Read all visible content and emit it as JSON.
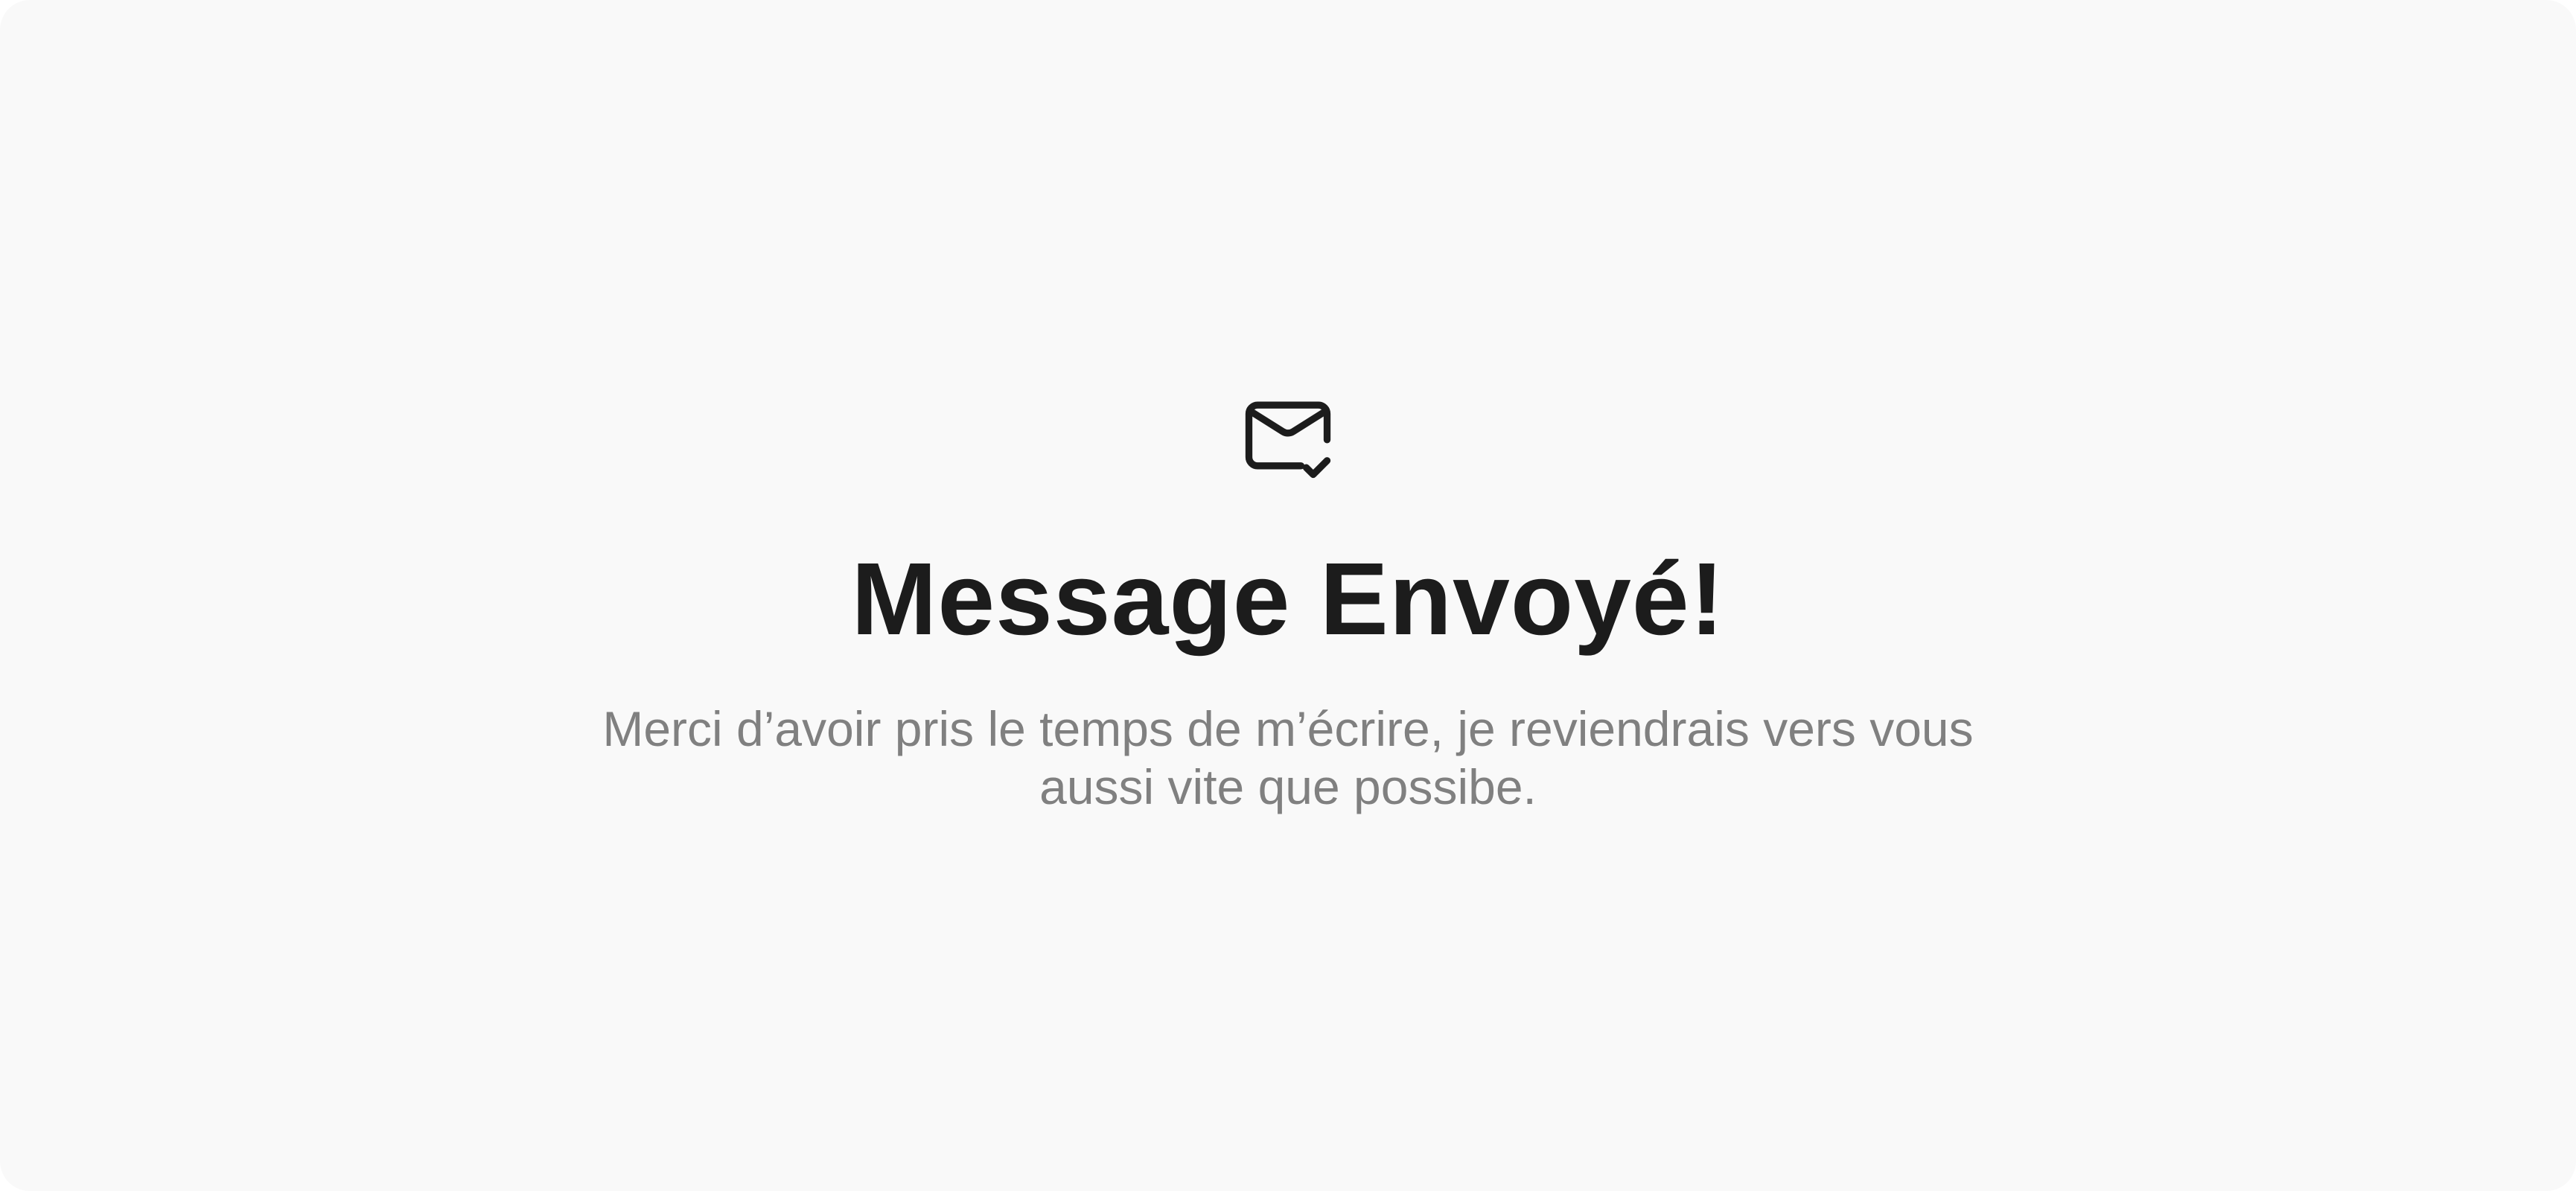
{
  "colors": {
    "background": "#f9f9f9",
    "title": "#1c1c1c",
    "message": "#808080",
    "icon": "#1c1c1c"
  },
  "confirmation": {
    "icon": "mail-check-icon",
    "title": "Message Envoyé!",
    "message": "Merci d’avoir pris le temps de m’écrire, je reviendrais vers vous aussi vite que possibe."
  }
}
